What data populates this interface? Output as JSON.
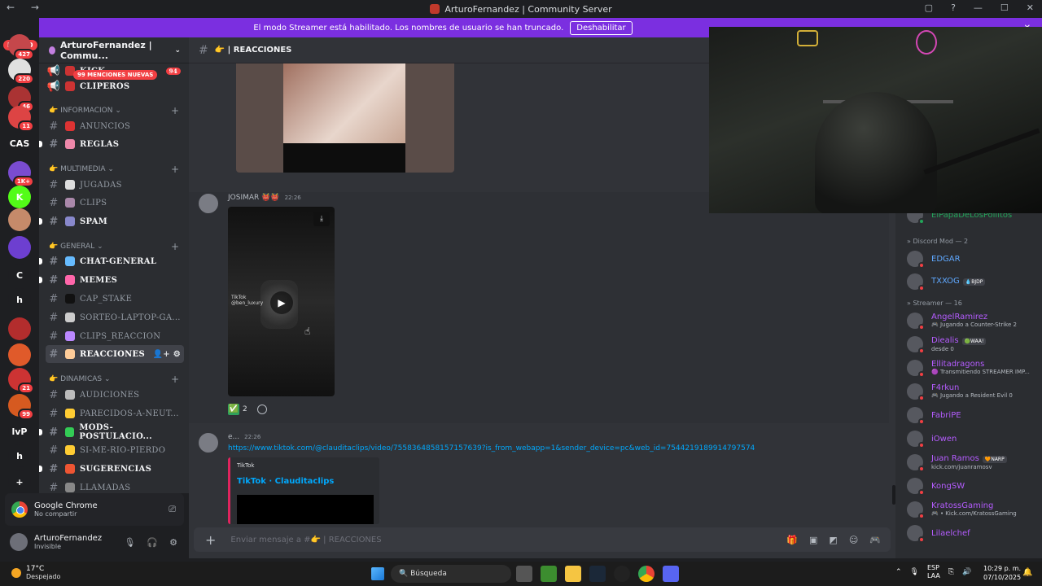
{
  "window": {
    "title": "ArturoFernandez | Community Server",
    "nav": "← →",
    "controls": [
      "▢",
      "?",
      "—",
      "☐",
      "✕"
    ]
  },
  "banner": {
    "text": "El modo Streamer está habilitado. Los nombres de usuario se han truncado.",
    "button": "Deshabilitar",
    "close": "✕"
  },
  "servers": {
    "new_label": "NUEVO",
    "items": [
      {
        "badge": "427",
        "color": "#c5474b"
      },
      {
        "badge": "220",
        "color": "#e0e0e0"
      },
      {
        "badge": "46",
        "color": "#a33"
      },
      {
        "badge": "11",
        "color": "#d44"
      },
      {
        "label": "CAS",
        "color": "#1e1f22"
      },
      {
        "badge": "1K+",
        "color": "#7a4cd0"
      },
      {
        "label": "K",
        "color": "#53fc18"
      },
      {
        "color": "#c58a6a"
      },
      {
        "color": "#6d3fd0"
      },
      {
        "label": "C",
        "color": "#1e1f22"
      },
      {
        "label": "h",
        "color": "#1e1f22"
      },
      {
        "color": "#b32d2d"
      },
      {
        "color": "#e05a2a"
      },
      {
        "badge": "21",
        "color": "#c33"
      },
      {
        "badge": "99",
        "color": "#d65a20"
      },
      {
        "label": "lvP",
        "color": "#1e1f22"
      },
      {
        "label": "h",
        "color": "#1e1f22"
      },
      {
        "label": "+",
        "color": "#1e1f22"
      }
    ]
  },
  "sidebar": {
    "server_name": "ArturoFernandez | Commu...",
    "new_mentions": "99 MENCIONES NUEVAS",
    "top": [
      {
        "name": "KICK",
        "badge": "94"
      },
      {
        "name": "CLIPEROS"
      }
    ],
    "categories": [
      {
        "label": "👉 INFORMACION",
        "channels": [
          {
            "name": "ANUNCIOS",
            "emoji_color": "#d33"
          },
          {
            "name": "REGLAS",
            "emoji_color": "#e8a",
            "unread": true
          }
        ]
      },
      {
        "label": "👉 MULTIMEDIA",
        "channels": [
          {
            "name": "JUGADAS",
            "emoji_color": "#ddd"
          },
          {
            "name": "CLIPS",
            "emoji_color": "#a8a"
          },
          {
            "name": "SPAM",
            "emoji_color": "#88c",
            "unread": true
          }
        ]
      },
      {
        "label": "👉 GENERAL",
        "channels": [
          {
            "name": "CHAT-GENERAL",
            "emoji_color": "#6bf",
            "unread": true
          },
          {
            "name": "MEMES",
            "emoji_color": "#f6a",
            "unread": true
          },
          {
            "name": "CAP_STAKE",
            "emoji_color": "#111"
          },
          {
            "name": "SORTEO-LAPTOP-GA...",
            "emoji_color": "#ccc"
          },
          {
            "name": "CLIPS_REACCION",
            "emoji_color": "#b8f"
          },
          {
            "name": "REACCIONES",
            "emoji_color": "#fc9",
            "active": true
          }
        ]
      },
      {
        "label": "👉 DINAMICAS",
        "channels": [
          {
            "name": "AUDICIONES",
            "emoji_color": "#bbb"
          },
          {
            "name": "PARECIDOS-A-NEUT...",
            "emoji_color": "#fc3"
          },
          {
            "name": "MODS-POSTULACIO...",
            "emoji_color": "#3c5",
            "unread": true
          },
          {
            "name": "SI-ME-RIO-PIERDO",
            "emoji_color": "#fc3"
          },
          {
            "name": "SUGERENCIAS",
            "emoji_color": "#e53",
            "unread": true
          },
          {
            "name": "LLAMADAS",
            "emoji_color": "#888"
          }
        ]
      }
    ]
  },
  "activity": {
    "app": "Google Chrome",
    "status": "No compartir"
  },
  "user": {
    "name": "ArturoFernandez",
    "status": "Invisible"
  },
  "chat": {
    "channel": "👉 | REACCIONES",
    "msg2": {
      "author": "JOSIMAR 👹👹",
      "time": "22:26",
      "tiktok": "TikTok",
      "tiktok_handle": "@ben_luxury",
      "reaction": "✅",
      "count": "2"
    },
    "msg3": {
      "author": "e...",
      "time": "22:26",
      "link": "https://www.tiktok.com/@clauditaclips/video/7558364858157157639?is_from_webapp=1&sender_device=pc&web_id=7544219189914797574",
      "embed_provider": "TikTok",
      "embed_title": "TikTok · Clauditaclips"
    },
    "composer": "Enviar mensaje a #👉 | REACCIONES"
  },
  "members": {
    "top_name": "ElPapaDeLosPollitos",
    "groups": [
      {
        "label": "» Discord Mod — 2",
        "items": [
          {
            "name": "EDGAR",
            "color": "#5fa8ff"
          },
          {
            "name": "TXXOG",
            "color": "#5fa8ff",
            "tag": "💧BJDP"
          }
        ]
      },
      {
        "label": "» Streamer — 16",
        "items": [
          {
            "name": "AngelRamirez",
            "color": "#b55cff",
            "sub": "🎮 Jugando a Counter-Strike 2"
          },
          {
            "name": "Diealis",
            "color": "#b55cff",
            "tag": "🟢WAA!",
            "sub": "desde 0"
          },
          {
            "name": "Ellitadragons",
            "color": "#b55cff",
            "sub": "🟣 Transmitiendo STREAMER IMP..."
          },
          {
            "name": "F4rkun",
            "color": "#b55cff",
            "sub": "🎮 Jugando a Resident Evil 0"
          },
          {
            "name": "FabriPE",
            "color": "#b55cff"
          },
          {
            "name": "iOwen",
            "color": "#b55cff"
          },
          {
            "name": "Juan Ramos",
            "color": "#b55cff",
            "tag": "🧡NARP",
            "sub": "kick.com/juanramosv"
          },
          {
            "name": "KongSW",
            "color": "#b55cff"
          },
          {
            "name": "KratossGaming",
            "color": "#b55cff",
            "sub": "🎮 • Kick.com/KratossGaming"
          },
          {
            "name": "Lilaelchef",
            "color": "#b55cff"
          }
        ]
      }
    ]
  },
  "taskbar": {
    "temp": "17°C",
    "weather": "Despejado",
    "search": "Búsqueda",
    "lang": "ESP",
    "region": "LAA",
    "time": "10:29 p. m.",
    "date": "07/10/2025"
  }
}
